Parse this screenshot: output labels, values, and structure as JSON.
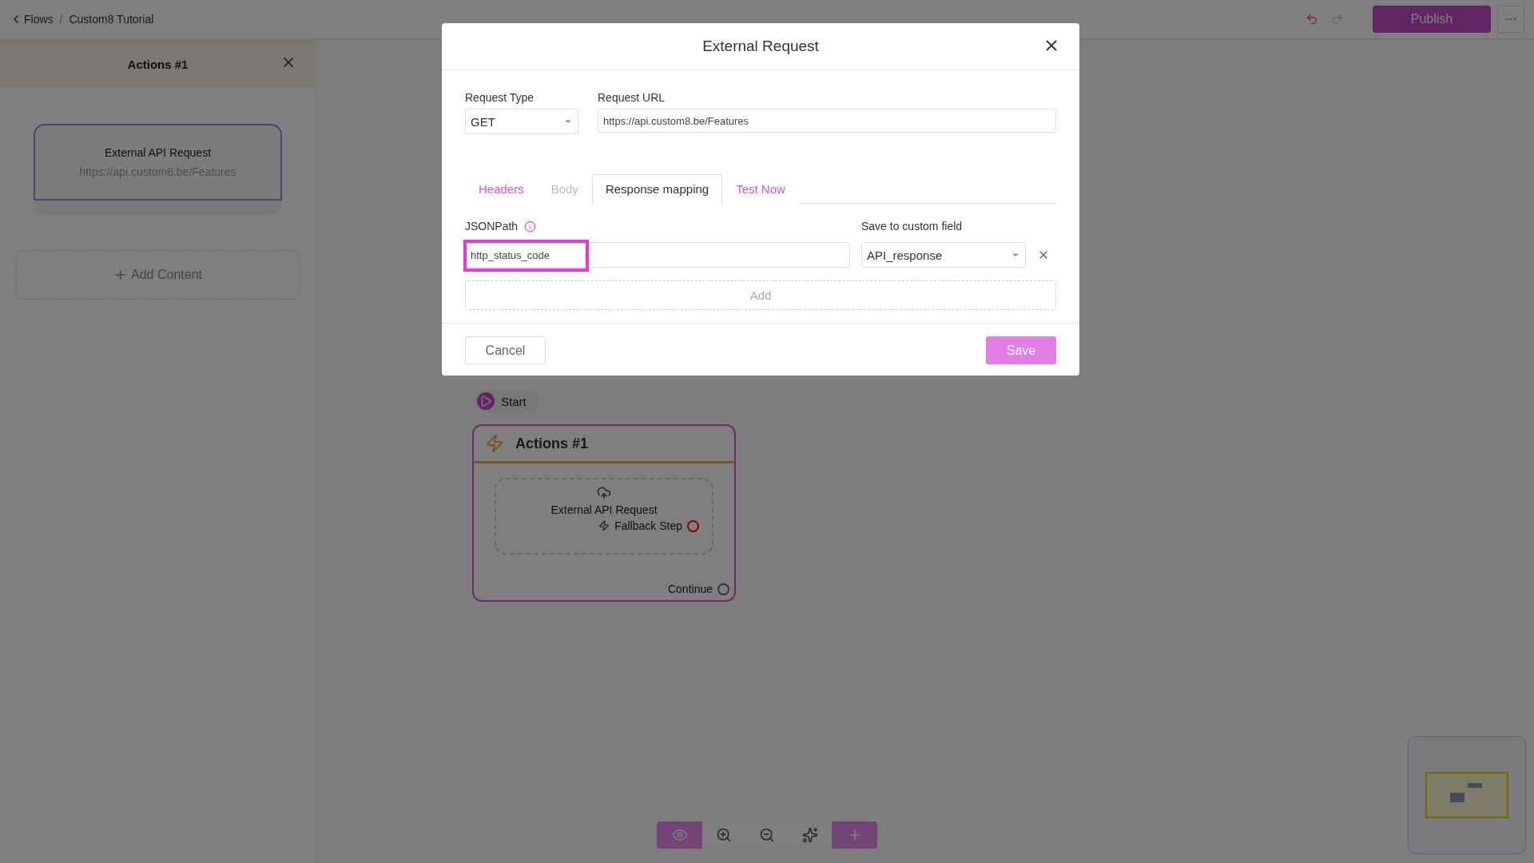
{
  "breadcrumb": {
    "back": "Flows",
    "separator": "/",
    "current": "Custom8 Tutorial"
  },
  "header": {
    "publish": "Publish"
  },
  "side_panel": {
    "title": "Actions #1",
    "card": {
      "title": "External API Request",
      "url": "https://api.custom8.be/Features"
    },
    "add_content": "Add Content"
  },
  "canvas": {
    "start": "Start",
    "node": {
      "title": "Actions #1",
      "step": {
        "title": "External API Request",
        "fallback": {
          "label": "Fallback Step",
          "kind": "error"
        }
      },
      "continue": {
        "label": "Continue",
        "kind": "default"
      }
    }
  },
  "toolbar": [
    {
      "kind": "preview",
      "selected": true
    },
    {
      "kind": "zoom-in",
      "selected": false
    },
    {
      "kind": "zoom-out",
      "selected": false
    },
    {
      "kind": "auto-layout",
      "selected": false
    },
    {
      "kind": "add",
      "selected": true
    }
  ],
  "dialog": {
    "title": "External Request",
    "request_type": {
      "label": "Request Type",
      "value": "GET"
    },
    "request_url": {
      "label": "Request URL",
      "value": "https://api.custom8.be/Features"
    },
    "tabs": [
      {
        "label": "Headers",
        "selected": false,
        "disabled": false
      },
      {
        "label": "Body",
        "selected": false,
        "disabled": true
      },
      {
        "label": "Response mapping",
        "selected": true,
        "disabled": false
      },
      {
        "label": "Test Now",
        "selected": false,
        "disabled": false
      }
    ],
    "mapping": {
      "jsonpath_label": "JSONPath",
      "field_label": "Save to custom field",
      "rows": [
        {
          "jsonpath": "http_status_code",
          "highlighted": true,
          "field": "API_response"
        }
      ],
      "add": "Add"
    },
    "cancel": "Cancel",
    "save": "Save"
  }
}
